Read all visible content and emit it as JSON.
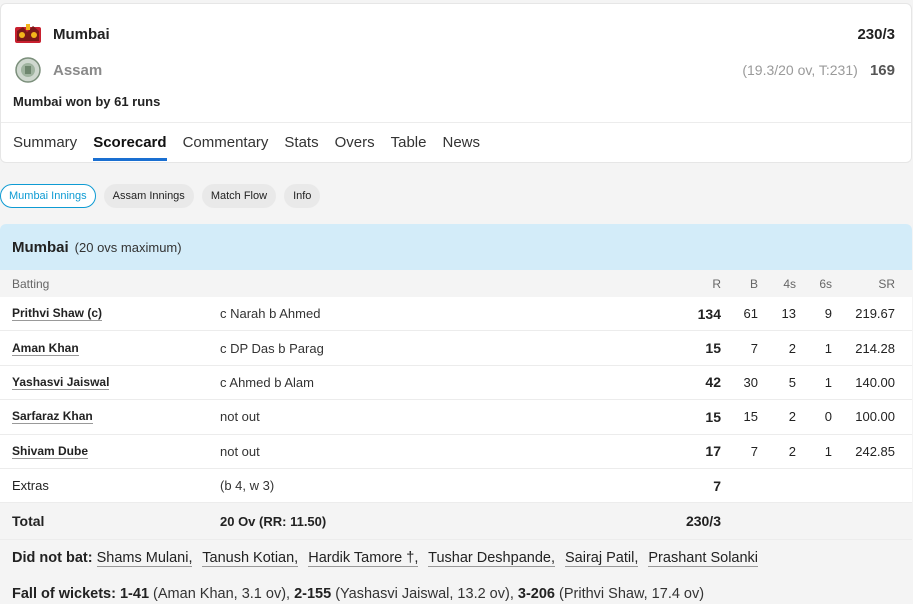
{
  "match": {
    "team1": {
      "name": "Mumbai",
      "score": "230/3",
      "logo_icon": "mumbai-crest-icon"
    },
    "team2": {
      "name": "Assam",
      "overs_info": "(19.3/20 ov, T:231)",
      "score": "169",
      "logo_icon": "assam-crest-icon"
    },
    "result": "Mumbai won by 61 runs"
  },
  "tabs": [
    "Summary",
    "Scorecard",
    "Commentary",
    "Stats",
    "Overs",
    "Table",
    "News"
  ],
  "pills": [
    "Mumbai Innings",
    "Assam Innings",
    "Match Flow",
    "Info"
  ],
  "innings": {
    "title": "Mumbai",
    "subtitle": "(20 ovs maximum)",
    "headers": {
      "batting": "Batting",
      "r": "R",
      "b": "B",
      "fours": "4s",
      "sixes": "6s",
      "sr": "SR"
    },
    "batters": [
      {
        "name": "Prithvi Shaw (c)",
        "dismissal": "c Narah b Ahmed",
        "r": "134",
        "b": "61",
        "fours": "13",
        "sixes": "9",
        "sr": "219.67"
      },
      {
        "name": "Aman Khan",
        "dismissal": "c DP Das b Parag",
        "r": "15",
        "b": "7",
        "fours": "2",
        "sixes": "1",
        "sr": "214.28"
      },
      {
        "name": "Yashasvi Jaiswal",
        "dismissal": "c Ahmed b Alam",
        "r": "42",
        "b": "30",
        "fours": "5",
        "sixes": "1",
        "sr": "140.00"
      },
      {
        "name": "Sarfaraz Khan",
        "dismissal": "not out",
        "r": "15",
        "b": "15",
        "fours": "2",
        "sixes": "0",
        "sr": "100.00"
      },
      {
        "name": "Shivam Dube",
        "dismissal": "not out",
        "r": "17",
        "b": "7",
        "fours": "2",
        "sixes": "1",
        "sr": "242.85"
      }
    ],
    "extras": {
      "label": "Extras",
      "detail": "(b 4, w 3)",
      "value": "7"
    },
    "total": {
      "label": "Total",
      "detail": "20 Ov (RR: 11.50)",
      "value": "230/3"
    },
    "did_not_bat": {
      "label": "Did not bat:",
      "players": [
        "Shams Mulani,",
        "Tanush Kotian,",
        "Hardik Tamore †,",
        "Tushar Deshpande,",
        "Sairaj Patil,",
        "Prashant Solanki"
      ]
    },
    "fall_of_wickets": {
      "label": "Fall of wickets:",
      "items": [
        {
          "score": "1-41",
          "detail": "(Aman Khan, 3.1 ov),"
        },
        {
          "score": "2-155",
          "detail": "(Yashasvi Jaiswal, 13.2 ov),"
        },
        {
          "score": "3-206",
          "detail": "(Prithvi Shaw, 17.4 ov)"
        }
      ]
    }
  }
}
